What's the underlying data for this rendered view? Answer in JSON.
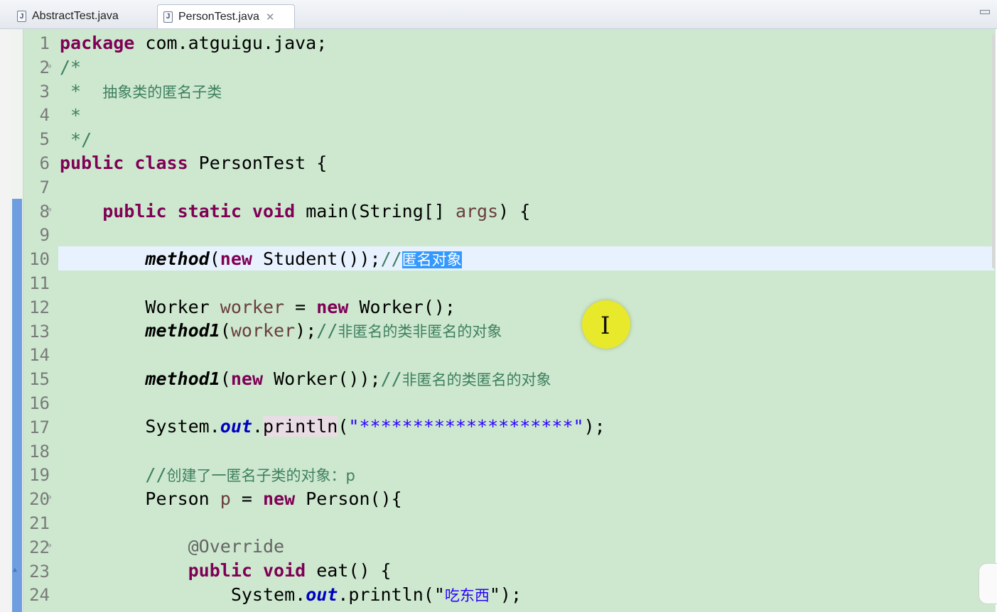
{
  "tabs": [
    {
      "label": "AbstractTest.java",
      "icon": "java-file-icon",
      "active": false
    },
    {
      "label": "PersonTest.java",
      "icon": "java-file-icon",
      "active": true,
      "closable": true
    }
  ],
  "editor": {
    "file": "PersonTest.java",
    "line_numbers": [
      "1",
      "2",
      "3",
      "4",
      "5",
      "6",
      "7",
      "8",
      "9",
      "10",
      "11",
      "12",
      "13",
      "14",
      "15",
      "16",
      "17",
      "18",
      "19",
      "20",
      "21",
      "22",
      "23",
      "24"
    ],
    "lines": {
      "l1": {
        "kw": "package",
        "rest": " com.atguigu.java;"
      },
      "l2": {
        "text": "/*"
      },
      "l3": {
        "star": " *  ",
        "zh": "抽象类的匿名子类"
      },
      "l4": {
        "text": " *"
      },
      "l5": {
        "text": " */"
      },
      "l6": {
        "kw": "public class",
        "rest": " PersonTest {"
      },
      "l8": {
        "indent": "    ",
        "kw": "public static void",
        "mid": " main(String[] ",
        "var": "args",
        "rest": ") {"
      },
      "l10": {
        "indent": "        ",
        "method": "method",
        "open": "(",
        "kw": "new",
        "rest": " Student());",
        "cmt": "//",
        "selected": "匿名对象"
      },
      "l12": {
        "indent": "        ",
        "type": "Worker ",
        "var": "worker",
        "eq": " = ",
        "kw": "new",
        "rest": " Worker();"
      },
      "l13": {
        "indent": "        ",
        "method": "method1",
        "open": "(",
        "var": "worker",
        "rest": ");",
        "cmt": "//",
        "zh": "非匿名的类非匿名的对象"
      },
      "l15": {
        "indent": "        ",
        "method": "method1",
        "open": "(",
        "kw": "new",
        "rest": " Worker());",
        "cmt": "//",
        "zh": "非匿名的类匿名的对象"
      },
      "l17": {
        "indent": "        ",
        "sys": "System.",
        "field": "out",
        "dot": ".",
        "println": "println",
        "open": "(",
        "str": "\"********************\"",
        "rest": ");"
      },
      "l19": {
        "indent": "        ",
        "cmt": "//",
        "zh": "创建了一匿名子类的对象：p"
      },
      "l20": {
        "indent": "        ",
        "type": "Person ",
        "var": "p",
        "eq": " = ",
        "kw": "new",
        "rest": " Person(){"
      },
      "l22": {
        "indent": "            ",
        "ann": "@Override"
      },
      "l23": {
        "indent": "            ",
        "kw": "public void",
        "rest": " eat() {"
      },
      "l24": {
        "indent": "                ",
        "sys": "System.",
        "field": "out",
        "dot": ".",
        "println": "println",
        "open": "(\"",
        "zh": "吃东西",
        "rest": "\");"
      }
    },
    "current_line": "10"
  },
  "colors": {
    "editor_bg": "#cde8cf",
    "keyword": "#7f0055",
    "comment": "#3f7f5f",
    "string": "#2a00ff",
    "field": "#0000c0",
    "selection": "#3399ff",
    "cursor_highlight": "#e9e92b"
  },
  "icons": {
    "tab_close": "close-icon",
    "minimize": "minimize-icon",
    "text_cursor": "i-beam-cursor-icon"
  }
}
